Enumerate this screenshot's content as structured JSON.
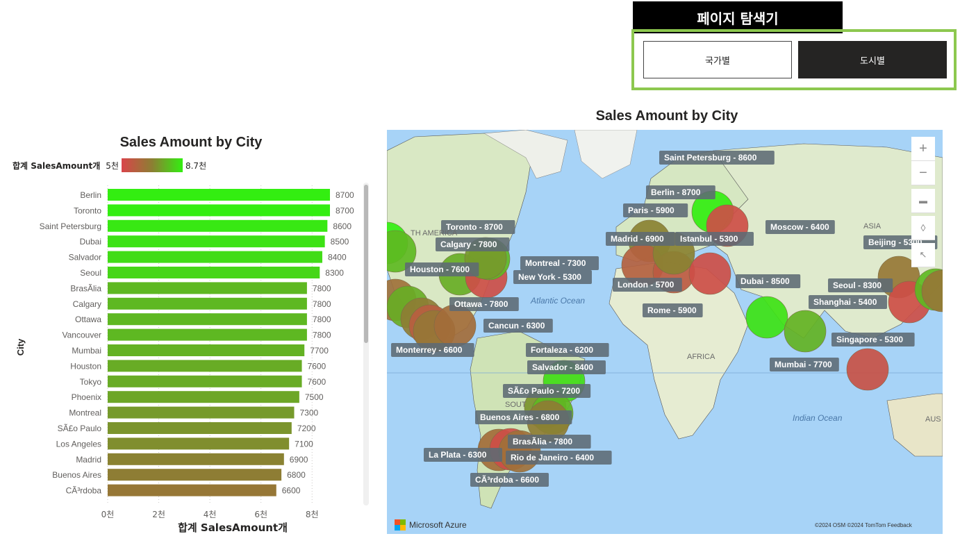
{
  "navigator": {
    "title": "페이지 탐색기",
    "buttons": [
      {
        "label": "국가별",
        "selected": false
      },
      {
        "label": "도시별",
        "selected": true
      }
    ]
  },
  "bar_visual": {
    "legend_label": "합계 SalesAmount개",
    "legend_min": "5천",
    "legend_max": "8.7천",
    "colors": {
      "low": "#d9444a",
      "mid": "#8c7f33",
      "high": "#33ee11"
    }
  },
  "map_visual": {
    "title": "Sales Amount by City",
    "zoom_in": "+",
    "zoom_out": "−",
    "brand": "Microsoft Azure",
    "attribution": "©2024 OSM ©2024 TomTom Feedback",
    "ocean_labels": [
      "Atlantic Ocean",
      "Indian Ocean"
    ],
    "continent_labels": [
      "AFRICA",
      "ASIA",
      "SOUT",
      "TH AMERICA",
      "AUS"
    ],
    "city_labels": [
      {
        "text": "Saint Petersburg - 8600",
        "value": 8600
      },
      {
        "text": "Berlin - 8700",
        "value": 8700
      },
      {
        "text": "Paris - 5900",
        "value": 5900
      },
      {
        "text": "Madrid - 6900",
        "value": 6900
      },
      {
        "text": "Istanbul - 5300",
        "value": 5300
      },
      {
        "text": "Moscow - 6400",
        "value": 6400
      },
      {
        "text": "London - 5700",
        "value": 5700
      },
      {
        "text": "Rome - 5900",
        "value": 5900
      },
      {
        "text": "Dubai - 8500",
        "value": 8500
      },
      {
        "text": "Seoul - 8300",
        "value": 8300
      },
      {
        "text": "Shanghai - 5400",
        "value": 5400
      },
      {
        "text": "Beijing - 5300",
        "value": 5300
      },
      {
        "text": "Singapore - 5300",
        "value": 5300
      },
      {
        "text": "Mumbai - 7700",
        "value": 7700
      },
      {
        "text": "Toronto - 8700",
        "value": 8700
      },
      {
        "text": "Calgary - 7800",
        "value": 7800
      },
      {
        "text": "Houston - 7600",
        "value": 7600
      },
      {
        "text": "Montreal - 7300",
        "value": 7300
      },
      {
        "text": "New York - 5300",
        "value": 5300
      },
      {
        "text": "Ottawa - 7800",
        "value": 7800
      },
      {
        "text": "Cancun - 6300",
        "value": 6300
      },
      {
        "text": "Monterrey - 6600",
        "value": 6600
      },
      {
        "text": "Fortaleza - 6200",
        "value": 6200
      },
      {
        "text": "Salvador - 8400",
        "value": 8400
      },
      {
        "text": "SÃ£o Paulo - 7200",
        "value": 7200
      },
      {
        "text": "Buenos Aires - 6800",
        "value": 6800
      },
      {
        "text": "BrasÃ­lia - 7800",
        "value": 7800
      },
      {
        "text": "La Plata - 6300",
        "value": 6300
      },
      {
        "text": "Rio de Janeiro - 6400",
        "value": 6400
      },
      {
        "text": "CÃ³rdoba - 6600",
        "value": 6600
      }
    ]
  },
  "chart_data": {
    "type": "bar",
    "orientation": "horizontal",
    "title": "Sales Amount by City",
    "xlabel": "합계 SalesAmount개",
    "ylabel": "City",
    "xlim": [
      0,
      8700
    ],
    "xticks": [
      "0천",
      "2천",
      "4천",
      "6천",
      "8천"
    ],
    "xtick_values": [
      0,
      2000,
      4000,
      6000,
      8000
    ],
    "grid": true,
    "color_scale": {
      "min": 5000,
      "max": 8700
    },
    "categories": [
      "Berlin",
      "Toronto",
      "Saint Petersburg",
      "Dubai",
      "Salvador",
      "Seoul",
      "BrasÃ­lia",
      "Calgary",
      "Ottawa",
      "Vancouver",
      "Mumbai",
      "Houston",
      "Tokyo",
      "Phoenix",
      "Montreal",
      "SÃ£o Paulo",
      "Los Angeles",
      "Madrid",
      "Buenos Aires",
      "CÃ³rdoba"
    ],
    "values": [
      8700,
      8700,
      8600,
      8500,
      8400,
      8300,
      7800,
      7800,
      7800,
      7800,
      7700,
      7600,
      7600,
      7500,
      7300,
      7200,
      7100,
      6900,
      6800,
      6600
    ]
  }
}
